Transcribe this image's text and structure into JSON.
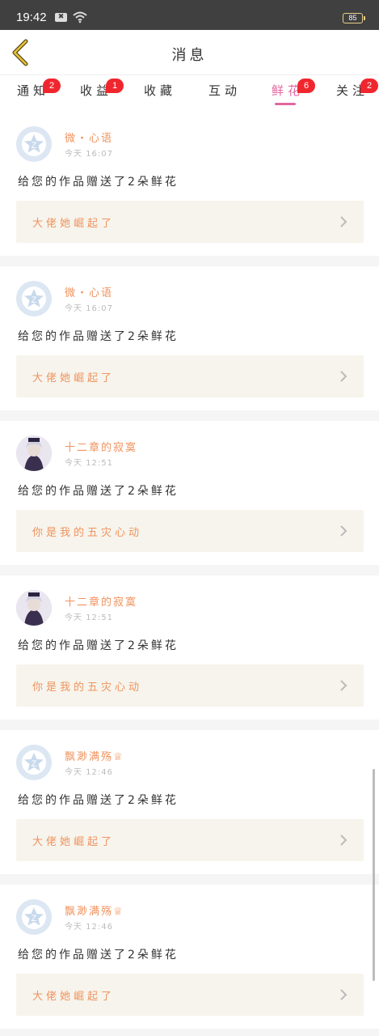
{
  "status_bar": {
    "time": "19:42",
    "battery": "85"
  },
  "header": {
    "title": "消息"
  },
  "tabs": [
    {
      "label": "通知",
      "badge": "2"
    },
    {
      "label": "收益",
      "badge": "1"
    },
    {
      "label": "收藏",
      "badge": ""
    },
    {
      "label": "互动",
      "badge": ""
    },
    {
      "label": "鲜花",
      "badge": "6"
    },
    {
      "label": "关注",
      "badge": "2"
    }
  ],
  "active_tab": "鲜花",
  "messages": [
    {
      "user": "微・心语",
      "time": "今天 16:07",
      "text": "给您的作品赠送了2朵鲜花",
      "work": "大佬她崛起了",
      "avatar": "default-avatar-icon"
    },
    {
      "user": "微・心语",
      "time": "今天 16:07",
      "text": "给您的作品赠送了2朵鲜花",
      "work": "大佬她崛起了",
      "avatar": "default-avatar-icon"
    },
    {
      "user": "十二章的寂寞",
      "time": "今天 12:51",
      "text": "给您的作品赠送了2朵鲜花",
      "work": "你是我的五灾心动",
      "avatar": "anime-avatar"
    },
    {
      "user": "十二章的寂寞",
      "time": "今天 12:51",
      "text": "给您的作品赠送了2朵鲜花",
      "work": "你是我的五灾心动",
      "avatar": "anime-avatar"
    },
    {
      "user": "飘渺满殇♕",
      "time": "今天 12:46",
      "text": "给您的作品赠送了2朵鲜花",
      "work": "大佬她崛起了",
      "avatar": "default-avatar-icon"
    },
    {
      "user": "飘渺满殇♕",
      "time": "今天 12:46",
      "text": "给您的作品赠送了2朵鲜花",
      "work": "大佬她崛起了",
      "avatar": "default-avatar-icon"
    }
  ],
  "colors": {
    "accent": "#e267a0",
    "username": "#f0935f",
    "badge": "#f0262e"
  }
}
